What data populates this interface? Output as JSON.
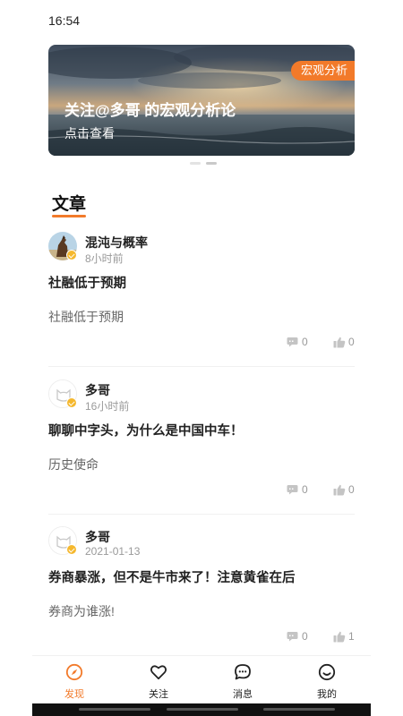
{
  "status_bar": {
    "time": "16:54"
  },
  "banner": {
    "tag": "宏观分析",
    "title": "关注@多哥 的宏观分析论",
    "subtitle": "点击查看",
    "page_count": 2,
    "active_page": 2
  },
  "section": {
    "title": "文章"
  },
  "posts": [
    {
      "author": "混沌与概率",
      "time": "8小时前",
      "title": "社融低于预期",
      "summary": "社融低于预期",
      "comments": "0",
      "likes": "0",
      "avatar": "horse-photo-avatar"
    },
    {
      "author": "多哥",
      "time": "16小时前",
      "title": "聊聊中字头，为什么是中国中车！",
      "summary": "历史使命",
      "comments": "0",
      "likes": "0",
      "avatar": "cat-outline-avatar"
    },
    {
      "author": "多哥",
      "time": "2021-01-13",
      "title": "券商暴涨，但不是牛市来了！注意黄雀在后",
      "summary": "券商为谁涨!",
      "comments": "0",
      "likes": "1",
      "avatar": "cat-outline-avatar"
    }
  ],
  "tab_bar": {
    "active": "discover",
    "tabs": [
      {
        "id": "discover",
        "label": "发现",
        "icon": "compass-icon"
      },
      {
        "id": "follow",
        "label": "关注",
        "icon": "heart-icon"
      },
      {
        "id": "messages",
        "label": "消息",
        "icon": "chat-bubble-icon"
      },
      {
        "id": "me",
        "label": "我的",
        "icon": "smiley-icon"
      }
    ]
  },
  "colors": {
    "accent": "#f27a2a",
    "badge": "#f5b82e",
    "muted_text": "#999999"
  }
}
